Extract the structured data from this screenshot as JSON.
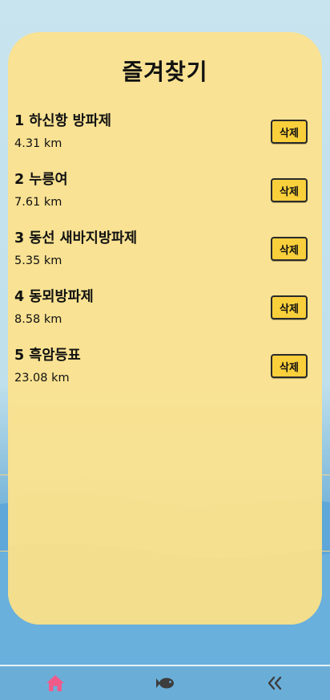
{
  "page": {
    "title": "즐겨찾기"
  },
  "favorites": [
    {
      "name": "1 하신항 방파제",
      "distance": "4.31 km",
      "delete_label": "삭제"
    },
    {
      "name": "2 누릉여",
      "distance": "7.61 km",
      "delete_label": "삭제"
    },
    {
      "name": "3 동선 새바지방파제",
      "distance": "5.35 km",
      "delete_label": "삭제"
    },
    {
      "name": "4 동뫼방파제",
      "distance": "8.58 km",
      "delete_label": "삭제"
    },
    {
      "name": "5 흑암등표",
      "distance": "23.08 km",
      "delete_label": "삭제"
    }
  ],
  "tabbar": {
    "items": [
      {
        "icon": "home-icon",
        "active": true
      },
      {
        "icon": "fish-icon",
        "active": false
      },
      {
        "icon": "double-chevron-left-icon",
        "active": false
      }
    ]
  },
  "colors": {
    "card": "#fbe28f",
    "button": "#f9cf3b",
    "tabbar": "#6aaed8",
    "active_tab": "#ef5b8a",
    "inactive_tab": "#3d3d3d"
  }
}
